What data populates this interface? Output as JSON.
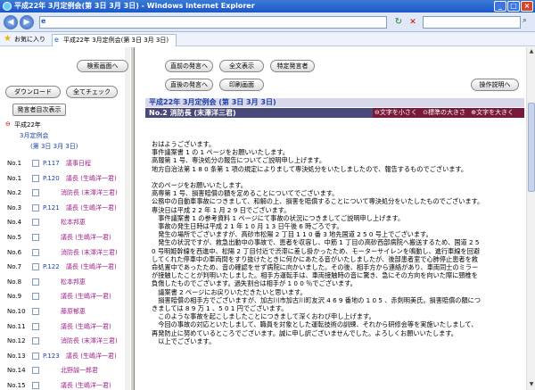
{
  "window": {
    "title": "平成22年 3月定例会(第 3日 3月 3日) - Windows Internet Explorer"
  },
  "favorites": {
    "label": "お気に入り",
    "tab": "平成22年 3月定例会(第 3日 3月 3日)"
  },
  "left": {
    "buttons": {
      "search": "検索画面へ",
      "download": "ダウンロード",
      "check_all": "全てチェック",
      "speaker_display": "発言者目次表示"
    },
    "tree": {
      "root": "平成22年",
      "level1": "3月定例会",
      "level2": "(第 3日 3月 3日)"
    },
    "rows": [
      {
        "no": "No.1",
        "page": "P.117",
        "speaker": "議事日程"
      },
      {
        "no": "No.1",
        "page": "P.120",
        "speaker": "議長 (生嶋洋一君)"
      },
      {
        "no": "No.2",
        "page": "",
        "speaker": "消防長 (末澤洋三君)"
      },
      {
        "no": "No.3",
        "page": "P.121",
        "speaker": "議長 (生嶋洋一君)"
      },
      {
        "no": "No.4",
        "page": "",
        "speaker": "松本邦恵"
      },
      {
        "no": "No.5",
        "page": "",
        "speaker": "議長 (生嶋洋一君)"
      },
      {
        "no": "No.6",
        "page": "",
        "speaker": "消防長 (末澤洋三君)"
      },
      {
        "no": "No.7",
        "page": "P.122",
        "speaker": "議長 (生嶋洋一君)"
      },
      {
        "no": "No.8",
        "page": "",
        "speaker": "松本邦恵"
      },
      {
        "no": "No.9",
        "page": "",
        "speaker": "議長 (生嶋洋一君)"
      },
      {
        "no": "No.10",
        "page": "",
        "speaker": "藤原郁恵"
      },
      {
        "no": "No.11",
        "page": "",
        "speaker": "議長 (生嶋洋一君)"
      },
      {
        "no": "No.12",
        "page": "",
        "speaker": "消防長 (末澤洋三君)"
      },
      {
        "no": "No.13",
        "page": "P.123",
        "speaker": "議長 (生嶋洋一君)"
      },
      {
        "no": "No.14",
        "page": "",
        "speaker": "北野誠一郎君"
      },
      {
        "no": "No.15",
        "page": "",
        "speaker": "議長 (生嶋洋一君)"
      },
      {
        "no": "No.16",
        "page": "",
        "speaker": ""
      }
    ]
  },
  "right": {
    "buttons": {
      "prev": "直前の発言へ",
      "all": "全文表示",
      "specific": "特定発言者",
      "next": "直後の発言へ",
      "print": "印刷画面",
      "help": "操作説明へ"
    },
    "title": "平成22年 3月定例会 (第 3日 3月 3日)",
    "subtitle": "No.2 消防長 (末澤洋三君)",
    "font_controls": {
      "smaller": "⊖文字を小さく",
      "normal": "⊙標準の大きさ",
      "larger": "⊕文字を大きく"
    },
    "paragraphs": [
      "おはようございます。",
      "事件議案書 1 の 1 ページをお願いいたします。",
      "高報第 1 号、専決処分の報告についてご説明申し上げます。",
      "地方自治法第 1 8 0 条第 1 項の規定によりまして専決処分をいたしましたので、報告するものでございます。",
      "",
      "次のページをお願いいたします。",
      "高専第 1 号、損害賠償の額を定めることについてでございます。",
      "公務中の自動車事故につきまして、和解の上、損害を賠償することについて専決処分をいたしたものでございます。",
      "専決日は平成 2 2 年 1 月 2 9 日でございます。",
      "　事件議案書 1 の参考資料 1 ページにて事故の状況につきましてご説明申し上げます。",
      "　事故の発生日時は平成 2 1 年 1 0 月 1 3 日午後 6 時ごろです。",
      "　発生の場所でございますが、高砂市松陽 2 丁目 1 1 0 番 3 地先国道 2 5 0 号上でございます。",
      "　発生の状況ですが、救急出動中の事故で、患者を収容し、中筋 1 丁目の高砂西部病院へ搬送するため、国道 2 5",
      "0 号明姫幹線を西進中、松陽 2 丁目付近で渋滞に差し掛かったため、モーターサイレンを鳴動し、進行車線を回避",
      "してくれた停車中の車両間をすり抜けたときに何かにあたる音がいたしましたが、後部患者室で心肺停止患者を救",
      "命処置中であったため、音の確認をせず病院に向かいました。その後、相手方から連絡があり、車両同士のミラー",
      "が接触したことが判明いたしました。相手方運転手は、車両接触時の音に驚き、急にその方向を向いた際に頸椎を",
      "負傷したものでございます。過失割合は相手が 1 0 0 ％でございます。",
      "　議案書 2 ページにお戻りいただきたいと思います。",
      "　損害賠償の相手方でございますが、加古川市加古川町友沢 4 6 9 番地の 1 0 5 、赤剣明美氏。損害賠償の額につ",
      "きましては 8 9 万 1 、5 0 1 円でございます。",
      "　このような事故を起こしましたことにつきまして深くおわび申し上げます。",
      "　今回の事故の対応といたしまして、職員を対象とした運転技術の訓練、それから研修会等を実施いたしまして、",
      "再発防止に努めているところでございます。誠に申し訳ございませんでした。よろしくお願いいたします。",
      "　以上でございます。"
    ]
  }
}
